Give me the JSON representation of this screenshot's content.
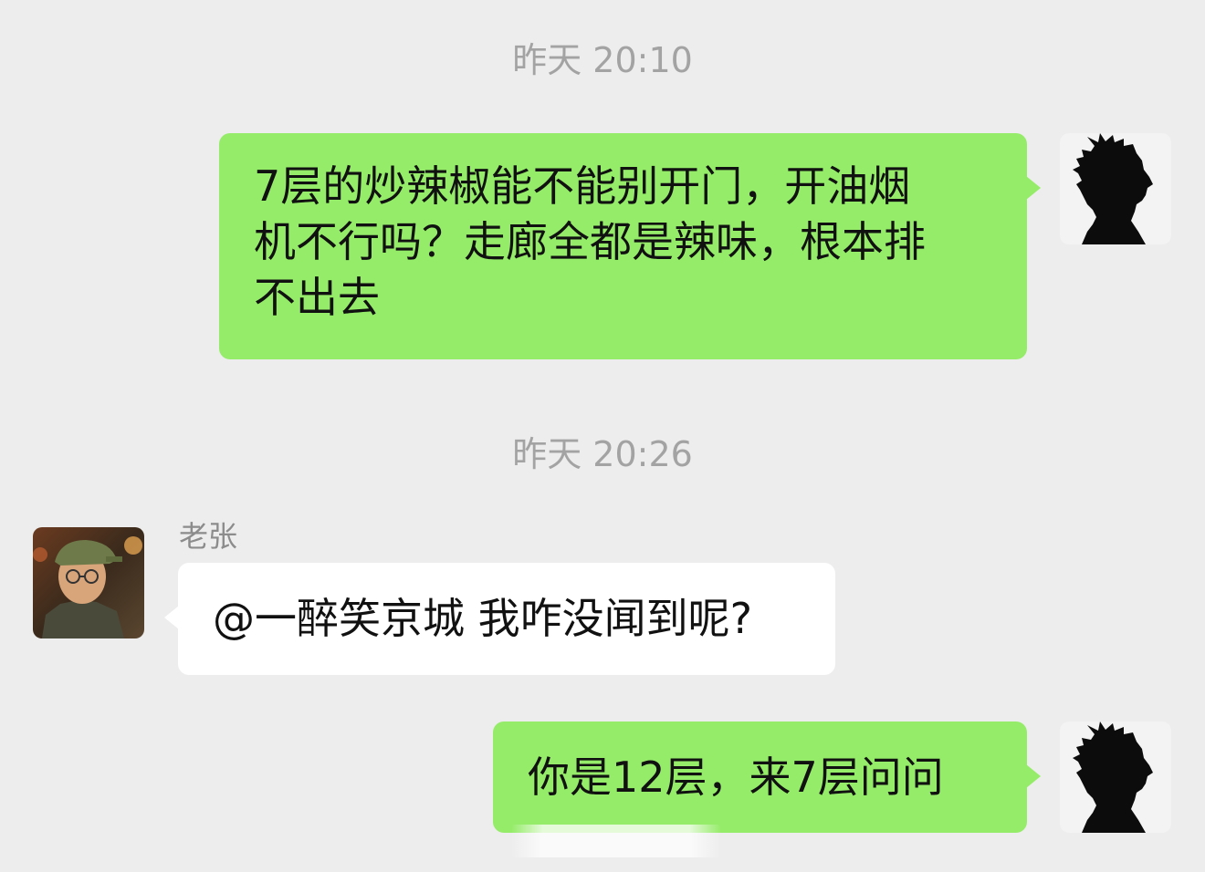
{
  "messages": [
    {
      "timestamp": "昨天 20:10",
      "text": "7层的炒辣椒能不能别开门，开油烟机不行吗？走廊全都是辣味，根本排不出去",
      "line1": "7层的炒辣椒能不能别开门，开油烟",
      "line2": "机不行吗？走廊全都是辣味，根本排",
      "line3": "不出去"
    },
    {
      "timestamp": "昨天 20:26",
      "sender": "老张",
      "text": "@一醉笑京城 我咋没闻到呢?"
    },
    {
      "text": "你是12层，来7层问问"
    }
  ],
  "avatars": {
    "self": "silhouette-profile",
    "other": "man-with-cap-photo"
  },
  "colors": {
    "background": "#ededed",
    "outgoing_bubble": "#95ec69",
    "incoming_bubble": "#ffffff",
    "timestamp": "#a3a3a3"
  }
}
